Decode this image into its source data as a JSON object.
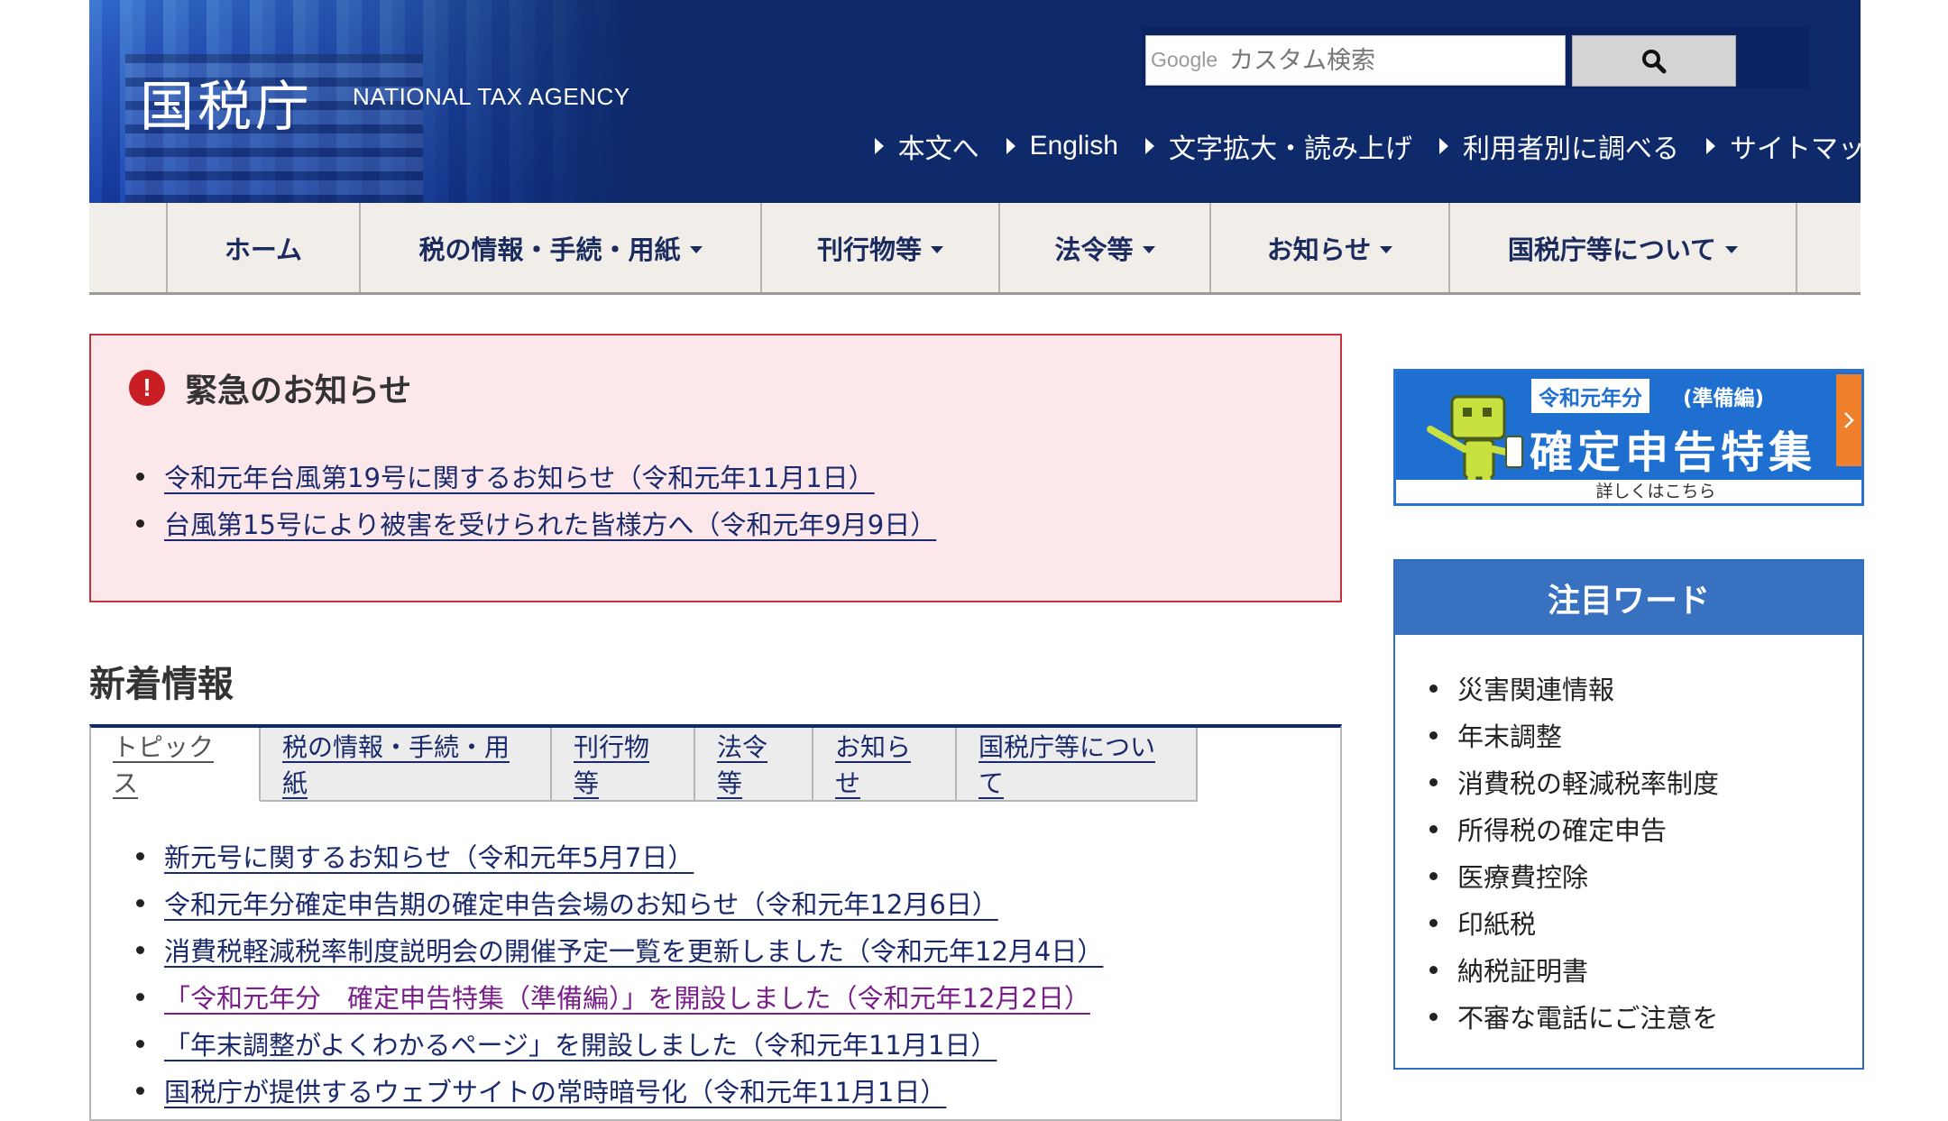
{
  "header": {
    "logo_jp": "国税庁",
    "logo_en": "NATIONAL TAX AGENCY",
    "search": {
      "brand": "Google",
      "placeholder": "カスタム検索"
    },
    "util_links": [
      "本文へ",
      "English",
      "文字拡大・読み上げ",
      "利用者別に調べる",
      "サイトマップ"
    ]
  },
  "gnav": {
    "items": [
      {
        "label": "ホーム"
      },
      {
        "label": "税の情報・手続・用紙"
      },
      {
        "label": "刊行物等"
      },
      {
        "label": "法令等"
      },
      {
        "label": "お知らせ"
      },
      {
        "label": "国税庁等について"
      }
    ]
  },
  "emergency": {
    "title": "緊急のお知らせ",
    "items": [
      "令和元年台風第19号に関するお知らせ（令和元年11月1日）",
      "台風第15号により被害を受けられた皆様方へ（令和元年9月9日）"
    ]
  },
  "news": {
    "heading": "新着情報",
    "tabs": [
      "トピックス",
      "税の情報・手続・用紙",
      "刊行物等",
      "法令等",
      "お知らせ",
      "国税庁等について"
    ],
    "active_tab": "トピックス",
    "items": [
      "新元号に関するお知らせ（令和元年5月7日）",
      "令和元年分確定申告期の確定申告会場のお知らせ（令和元年12月6日）",
      "消費税軽減税率制度説明会の開催予定一覧を更新しました（令和元年12月4日）",
      "「令和元年分　確定申告特集（準備編）」を開設しました（令和元年12月2日）",
      "「年末調整がよくわかるページ」を開設しました（令和元年11月1日）",
      "国税庁が提供するウェブサイトの常時暗号化（令和元年11月1日）"
    ]
  },
  "banner": {
    "tag": "令和元年分",
    "tag_sub": "(準備編)",
    "main": "確定申告特集",
    "foot": "詳しくはこちら"
  },
  "words": {
    "heading": "注目ワード",
    "items": [
      "災害関連情報",
      "年末調整",
      "消費税の軽減税率制度",
      "所得税の確定申告",
      "医療費控除",
      "印紙税",
      "納税証明書",
      "不審な電話にご注意を"
    ]
  },
  "colors": {
    "header_bg": "#0e2a6b",
    "emergency_bg": "#fce8ea",
    "emergency_border": "#c4343f",
    "link": "#1a2a6c",
    "visited_link": "#7a1f8a",
    "sidebar_accent": "#3771c0",
    "banner_arrow": "#f07f2c"
  }
}
